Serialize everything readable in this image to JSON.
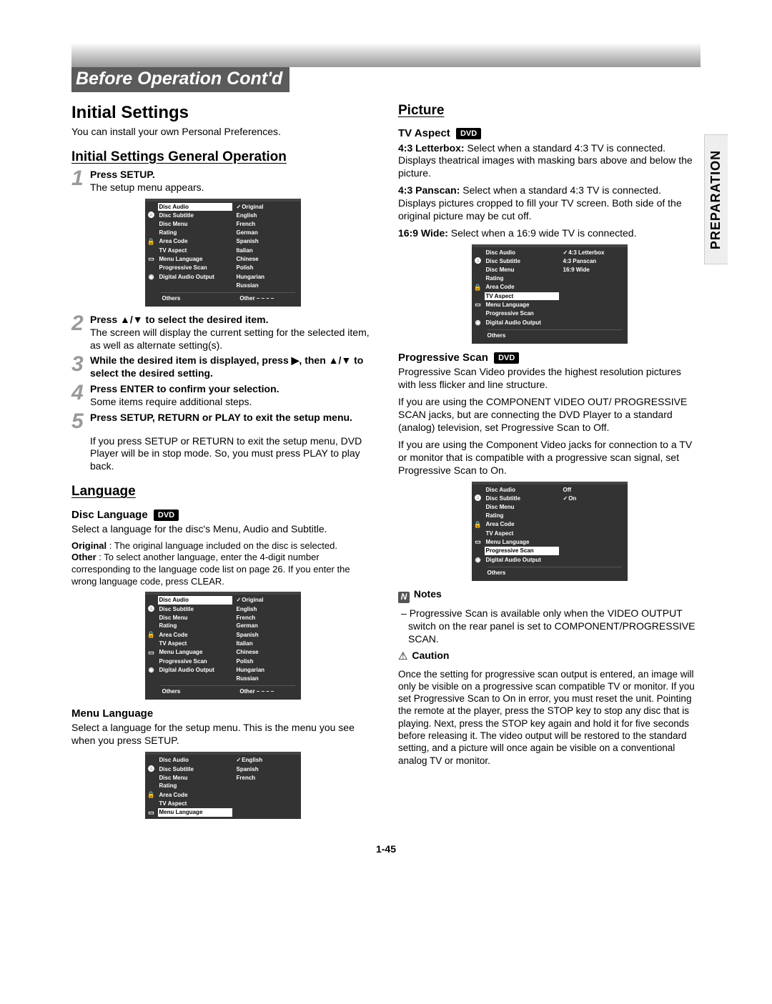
{
  "chapter_title": "Before Operation Cont'd",
  "side_tab": "PREPARATION",
  "page_number": "1-45",
  "left": {
    "h1": "Initial Settings",
    "intro": "You can install your own Personal Preferences.",
    "h2_general": "Initial Settings General Operation",
    "steps": [
      {
        "num": "1",
        "lead": "Press SETUP.",
        "body": "The setup menu appears."
      },
      {
        "num": "2",
        "lead": "Press ▲/▼ to select the desired item.",
        "body": "The screen will display the current setting for the selected item, as well as alternate setting(s)."
      },
      {
        "num": "3",
        "lead": "While the desired item is displayed, press ▶, then ▲/▼ to select the desired setting.",
        "body": ""
      },
      {
        "num": "4",
        "lead": "Press ENTER to confirm your selection.",
        "body": "Some items require additional steps."
      },
      {
        "num": "5",
        "lead": "Press SETUP, RETURN or PLAY to exit the setup menu.",
        "body": ""
      }
    ],
    "step5_tail": "If you press SETUP or RETURN to exit the setup menu, DVD Player will be in stop mode. So, you must press PLAY to play back.",
    "h2_language": "Language",
    "h3_disc_language": "Disc Language",
    "disc_lang_p1": "Select a language for the disc's Menu, Audio and Subtitle.",
    "disc_lang_original_label": "Original",
    "disc_lang_original_text": " : The original language included on the disc is selected.",
    "disc_lang_other_label": "Other",
    "disc_lang_other_text": " : To select another language, enter the 4-digit number corresponding to the language code list on page 26. If you enter the wrong language code, press CLEAR.",
    "h3_menu_language": "Menu Language",
    "menu_lang_text": "Select a language for the setup menu. This is the menu you see when you press SETUP."
  },
  "right": {
    "h2_picture": "Picture",
    "h3_tv_aspect": "TV Aspect",
    "tv_43lb_label": "4:3 Letterbox:",
    "tv_43lb_text": " Select when a standard 4:3 TV is connected. Displays theatrical images with masking bars above and below the picture.",
    "tv_43ps_label": "4:3 Panscan:",
    "tv_43ps_text": " Select when a standard 4:3 TV is connected. Displays pictures cropped to fill your TV screen. Both side of the original picture may be cut off.",
    "tv_169_label": "16:9 Wide:",
    "tv_169_text": " Select when a 16:9 wide TV is connected.",
    "h3_progscan": "Progressive Scan",
    "ps_p1": "Progressive Scan Video provides the highest resolution pictures with less flicker and line structure.",
    "ps_p2": "If you are using the COMPONENT VIDEO OUT/ PROGRESSIVE SCAN jacks, but are connecting the DVD Player to a standard (analog) television, set Progressive Scan to Off.",
    "ps_p3": "If you are using the Component Video jacks for connection to a TV or monitor that is compatible with a progressive scan signal, set Progressive Scan to On.",
    "notes_label": "Notes",
    "notes_text": "Progressive Scan is available only when the VIDEO OUTPUT switch on the rear panel is set to COMPONENT/PROGRESSIVE SCAN.",
    "caution_label": "Caution",
    "caution_text": "Once the setting for progressive scan output is entered, an image will only be visible on a progressive scan compatible TV or monitor. If you set Progressive Scan to On in error, you must reset the unit. Pointing the remote at the player, press the STOP key to stop any disc that is playing. Next, press the STOP key again and hold it for five seconds before releasing it. The video output will be restored to the standard setting, and a picture will once again be visible on a conventional analog TV or monitor."
  },
  "menu": {
    "items": [
      "Disc Audio",
      "Disc Subtitle",
      "Disc Menu",
      "Rating",
      "Area Code",
      "TV Aspect",
      "Menu Language",
      "Progressive Scan",
      "Digital Audio Output"
    ],
    "others": "Others",
    "lang_values": [
      "Original",
      "English",
      "French",
      "German",
      "Spanish",
      "Italian",
      "Chinese",
      "Polish",
      "Hungarian",
      "Russian"
    ],
    "lang_other": "Other  – – – –",
    "tv_values": [
      "4:3 Letterbox",
      "4:3 Panscan",
      "16:9 Wide"
    ],
    "ps_values": [
      "Off",
      "On"
    ],
    "menu_lang_values": [
      "English",
      "Spanish",
      "French"
    ]
  },
  "dvd_tag": "DVD"
}
